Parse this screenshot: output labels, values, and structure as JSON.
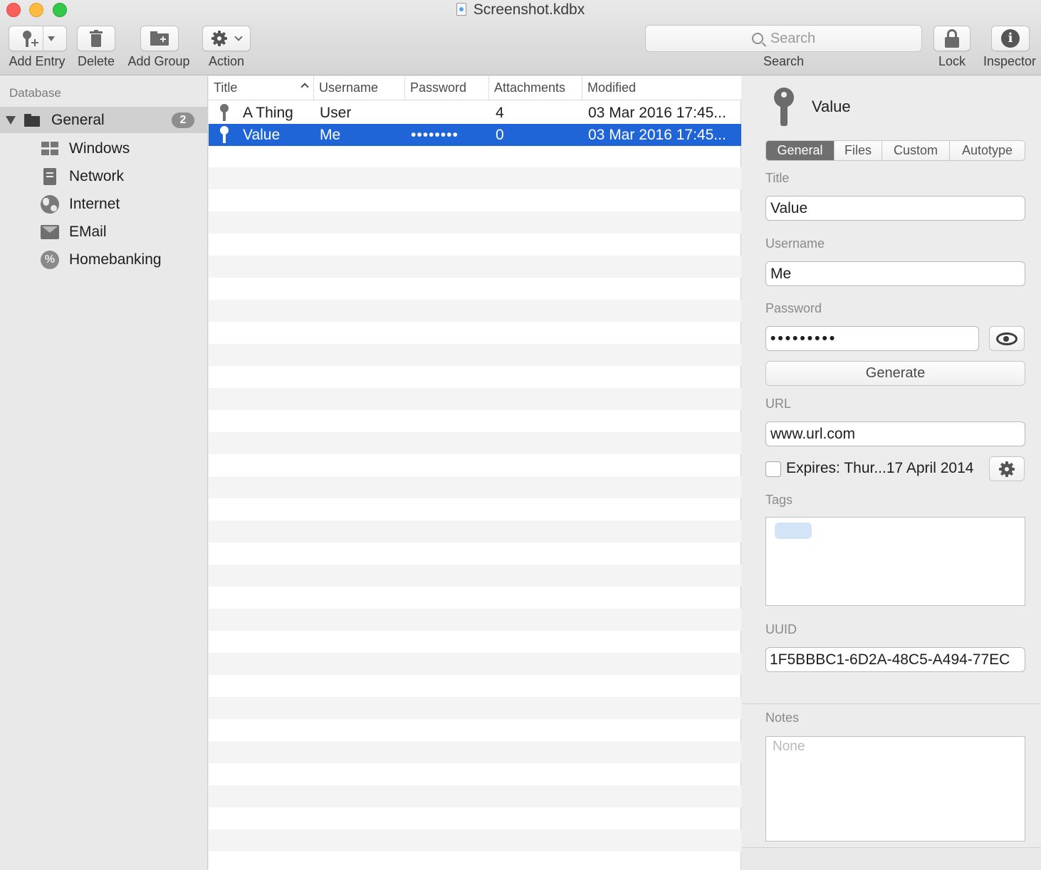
{
  "window": {
    "title": "Screenshot.kdbx"
  },
  "toolbar": {
    "add_entry": "Add Entry",
    "delete": "Delete",
    "add_group": "Add Group",
    "action": "Action",
    "search_placeholder": "Search",
    "search_label": "Search",
    "lock": "Lock",
    "inspector": "Inspector"
  },
  "sidebar": {
    "header": "Database",
    "group": {
      "label": "General",
      "count": "2"
    },
    "children": [
      {
        "label": "Windows",
        "icon": "windows-icon"
      },
      {
        "label": "Network",
        "icon": "network-icon"
      },
      {
        "label": "Internet",
        "icon": "globe-icon"
      },
      {
        "label": "EMail",
        "icon": "mail-icon"
      },
      {
        "label": "Homebanking",
        "icon": "percent-icon"
      }
    ]
  },
  "table": {
    "columns": [
      "Title",
      "Username",
      "Password",
      "Attachments",
      "Modified"
    ],
    "rows": [
      {
        "title": "A Thing",
        "username": "User",
        "password": "",
        "attachments": "4",
        "modified": "03 Mar 2016 17:45...",
        "selected": false
      },
      {
        "title": "Value",
        "username": "Me",
        "password": "••••••••",
        "attachments": "0",
        "modified": "03 Mar 2016 17:45...",
        "selected": true
      }
    ]
  },
  "inspector": {
    "title": "Value",
    "tabs": [
      "General",
      "Files",
      "Custom",
      "Autotype"
    ],
    "active_tab": "General",
    "title_label": "Title",
    "title_value": "Value",
    "username_label": "Username",
    "username_value": "Me",
    "password_label": "Password",
    "password_value": "•••••••••",
    "generate_label": "Generate",
    "url_label": "URL",
    "url_value": "www.url.com",
    "expires_label": "Expires: Thur...17 April 2014",
    "expires_checked": false,
    "tags_label": "Tags",
    "uuid_label": "UUID",
    "uuid_value": "1F5BBBC1-6D2A-48C5-A494-77EC",
    "notes_label": "Notes",
    "notes_placeholder": "None"
  },
  "colors": {
    "selection": "#1f65d8",
    "close": "#fc605c",
    "minimize": "#fdbc40",
    "zoom": "#34c84a"
  }
}
